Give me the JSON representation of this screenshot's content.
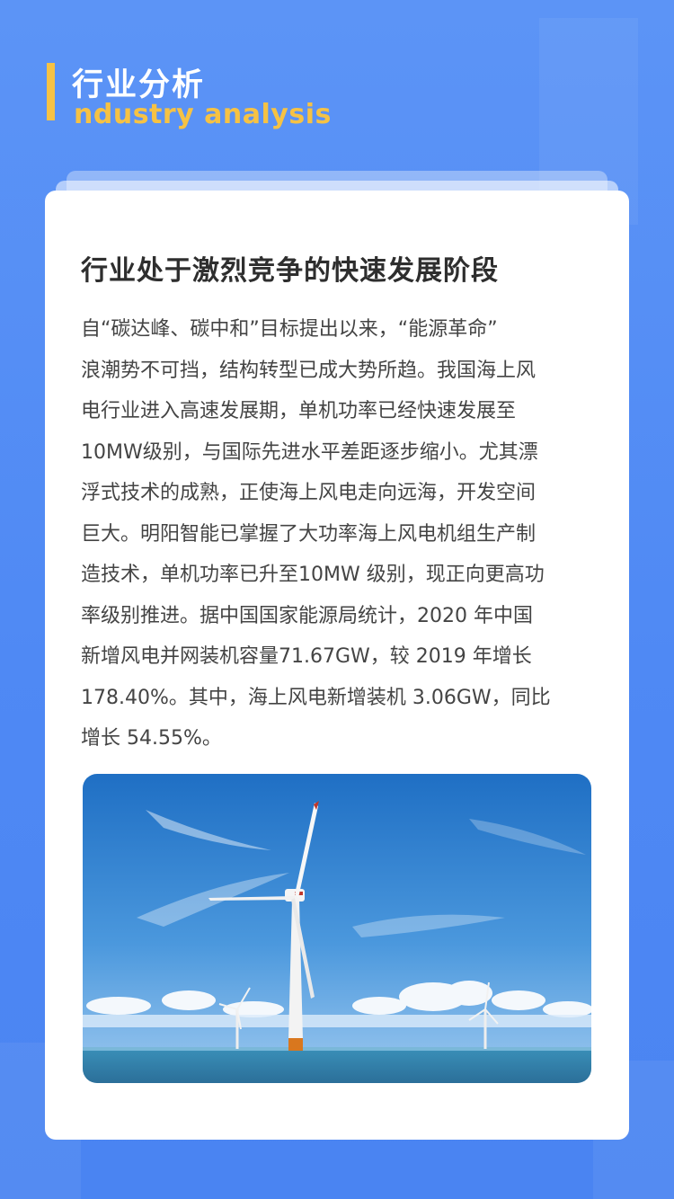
{
  "header": {
    "title_cn": "行业分析",
    "title_en": "ndustry analysis"
  },
  "article": {
    "heading": "行业处于激烈竞争的快速发展阶段",
    "lines": [
      "自“碳达峰、碳中和”目标提出以来，“能源革命”",
      "浪潮势不可挡，结构转型已成大势所趋。我国海上风",
      "电行业进入高速发展期，单机功率已经快速发展至",
      "10MW级别，与国际先进水平差距逐步缩小。尤其漂",
      "浮式技术的成熟，正使海上风电走向远海，开发空间",
      "巨大。明阳智能已掌握了大功率海上风电机组生产制",
      "造技术，单机功率已升至10MW 级别，现正向更高功",
      "率级别推进。据中国国家能源局统计，2020 年中国",
      "新增风电并网装机容量71.67GW，较 2019 年增长",
      "178.40%。其中，海上风电新增装机 3.06GW，同比",
      "增长 54.55%。"
    ]
  },
  "photo": {
    "subject": "offshore-wind-turbines"
  },
  "colors": {
    "background": "#4f89f4",
    "accent": "#f6c244",
    "card": "#ffffff",
    "text": "#444444"
  }
}
